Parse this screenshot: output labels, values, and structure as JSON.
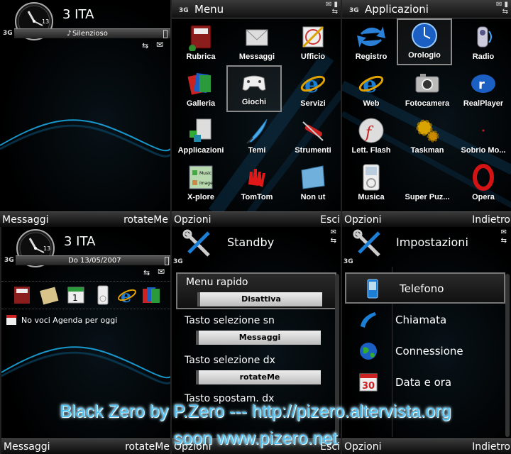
{
  "standby_top": {
    "tag": "3G",
    "operator": "3 ITA",
    "profile": "Silenzioso",
    "clock_date": "13",
    "softkeys": {
      "left": "Messaggi",
      "right": "rotateMe"
    }
  },
  "menu": {
    "tag": "3G",
    "title": "Menu",
    "items": [
      {
        "label": "Rubrica",
        "icon": "address-book-icon"
      },
      {
        "label": "Messaggi",
        "icon": "envelope-icon"
      },
      {
        "label": "Ufficio",
        "icon": "office-icon"
      },
      {
        "label": "Galleria",
        "icon": "gallery-icon"
      },
      {
        "label": "Giochi",
        "icon": "gamepad-icon"
      },
      {
        "label": "Servizi",
        "icon": "browser-icon"
      },
      {
        "label": "Applicazioni",
        "icon": "applications-icon"
      },
      {
        "label": "Temi",
        "icon": "themes-icon"
      },
      {
        "label": "Strumenti",
        "icon": "tools-icon"
      },
      {
        "label": "X-plore",
        "icon": "xplore-icon"
      },
      {
        "label": "TomTom",
        "icon": "tomtom-icon"
      },
      {
        "label": "Non ut",
        "icon": "folder-icon"
      }
    ],
    "softkeys": {
      "left": "Opzioni",
      "right": "Esci"
    }
  },
  "apps": {
    "tag": "3G",
    "title": "Applicazioni",
    "items": [
      {
        "label": "Registro",
        "icon": "log-arrows-icon"
      },
      {
        "label": "Orologio",
        "icon": "clock-icon"
      },
      {
        "label": "Radio",
        "icon": "radio-icon"
      },
      {
        "label": "Web",
        "icon": "web-icon"
      },
      {
        "label": "Fotocamera",
        "icon": "camera-icon"
      },
      {
        "label": "RealPlayer",
        "icon": "realplayer-icon"
      },
      {
        "label": "Lett. Flash",
        "icon": "flash-icon"
      },
      {
        "label": "Taskman",
        "icon": "gear-icon"
      },
      {
        "label": "Sobrio Mo...",
        "icon": "sobrio-icon"
      },
      {
        "label": "Musica",
        "icon": "music-player-icon"
      },
      {
        "label": "Super Puz...",
        "icon": "puzzle-icon"
      },
      {
        "label": "Opera",
        "icon": "opera-icon"
      }
    ],
    "softkeys": {
      "left": "Opzioni",
      "right": "Indietro"
    }
  },
  "standby_bottom": {
    "tag": "3G",
    "operator": "3 ITA",
    "date": "Do 13/05/2007",
    "clock_date": "13",
    "calendar_text": "No voci Agenda per oggi",
    "shortcuts": [
      "address-book-icon",
      "notes-icon",
      "calendar-icon",
      "ipod-icon",
      "browser-icon",
      "gallery-icon"
    ],
    "softkeys": {
      "left": "Messaggi",
      "right": "rotateMe"
    }
  },
  "standby_settings": {
    "tag": "3G",
    "title": "Standby",
    "items": [
      {
        "name": "Menu rapido",
        "value": "Disattiva"
      },
      {
        "name": "Tasto selezione sn",
        "value": "Messaggi"
      },
      {
        "name": "Tasto selezione dx",
        "value": "rotateMe"
      },
      {
        "name": "Tasto spostam. dx",
        "value": ""
      }
    ],
    "softkeys": {
      "left": "Opzioni",
      "right": "Esci"
    }
  },
  "impostazioni": {
    "tag": "3G",
    "title": "Impostazioni",
    "items": [
      {
        "label": "Telefono",
        "icon": "phone-icon"
      },
      {
        "label": "Chiamata",
        "icon": "call-icon"
      },
      {
        "label": "Connessione",
        "icon": "globe-icon"
      },
      {
        "label": "Data e ora",
        "icon": "calendar-30-icon"
      }
    ],
    "softkeys": {
      "left": "Opzioni",
      "right": "Indietro"
    }
  },
  "banner": {
    "line1": "Black Zero by P.Zero --- http://pizero.altervista.org",
    "line2": "soon  www.pizero.net"
  },
  "colors": {
    "accent": "#4fc1f4",
    "wave": "#1aa6e0"
  }
}
